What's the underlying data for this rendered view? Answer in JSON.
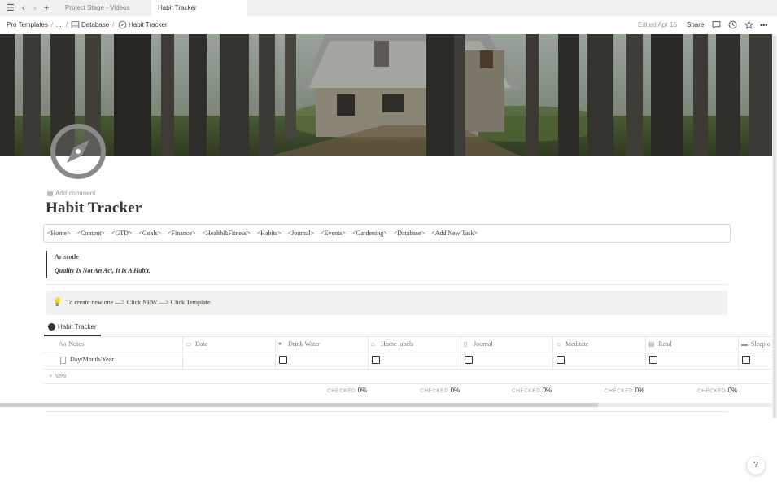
{
  "tabs": {
    "items": [
      {
        "label": "Project Stage - Videos"
      },
      {
        "label": "Habit Tracker"
      }
    ]
  },
  "breadcrumb": {
    "items": [
      "Pro Templates",
      "...",
      "Database",
      "Habit Tracker"
    ],
    "separators": "/"
  },
  "topbar": {
    "edited": "Edited Apr 16",
    "share": "Share",
    "more": "•••"
  },
  "page": {
    "add_comment": "Add comment",
    "title": "Habit Tracker",
    "nav_links": "<Home>—<Content>—<GTD>—<Goals>—<Finance>—<Health&Fitness>—<Habits>—<Journal>—<Events>—<Gardening>—<Database>—<Add New Task>",
    "quote_author": "Aristotle",
    "quote_text": "Quality Is Not An Act, It Is A Habit.",
    "callout_icon": "lightbulb-icon",
    "callout_text": "To create new one —> Click NEW —> Click Template"
  },
  "database": {
    "view_tab": "Habit Tracker",
    "columns": [
      {
        "label": "Notes",
        "icon": "Aa"
      },
      {
        "label": "Date",
        "icon": "calendar-icon"
      },
      {
        "label": "Drink Water",
        "icon": "glass-icon"
      },
      {
        "label": "Home labels",
        "icon": "home-icon"
      },
      {
        "label": "Journal",
        "icon": "book-icon"
      },
      {
        "label": "Meditate",
        "icon": "sun-icon"
      },
      {
        "label": "Read",
        "icon": "document-icon"
      },
      {
        "label": "Sleep o",
        "icon": "bed-icon"
      }
    ],
    "rows": [
      {
        "notes": "Day/Month/Year",
        "date": "",
        "drink_water": false,
        "home_labels": false,
        "journal": false,
        "meditate": false,
        "read": false,
        "sleep": false
      }
    ],
    "new_label": "New",
    "calc_label": "CHECKED",
    "calc_values": [
      "0%",
      "0%",
      "0%",
      "0%",
      "0%"
    ]
  },
  "help": "?"
}
